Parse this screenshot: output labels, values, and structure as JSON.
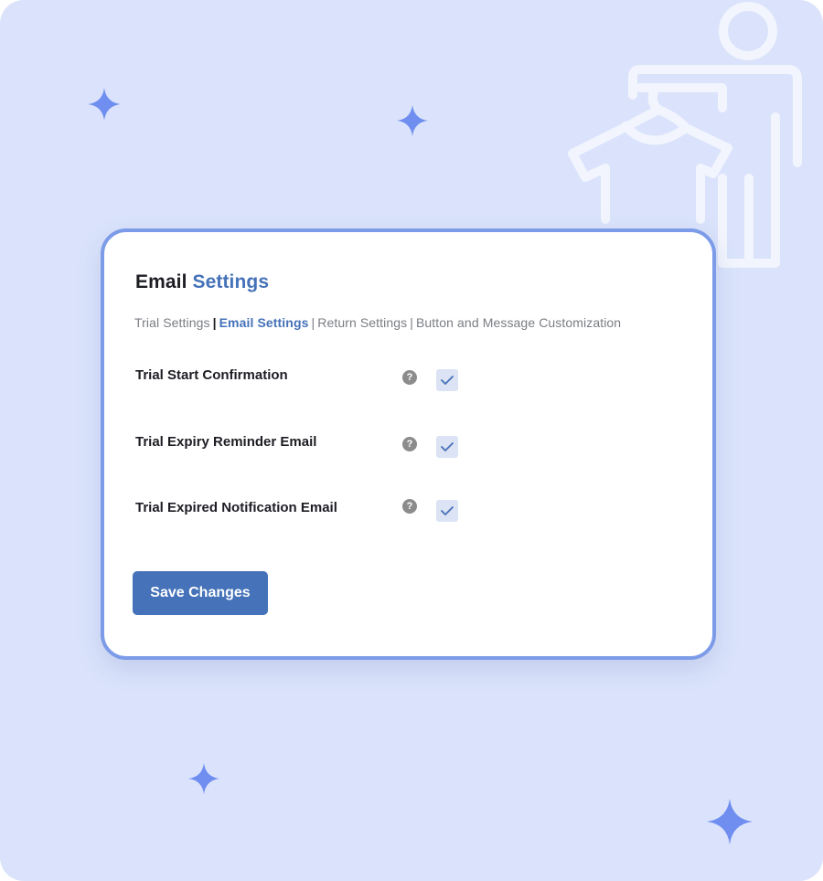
{
  "card": {
    "title_part1": "Email",
    "title_part2": "Settings"
  },
  "tabs": [
    {
      "label": "Trial Settings",
      "active": false
    },
    {
      "label": "Email Settings",
      "active": true
    },
    {
      "label": "Return Settings",
      "active": false
    },
    {
      "label": "Button and Message Customization",
      "active": false
    }
  ],
  "tab_separator": "|",
  "settings": [
    {
      "label": "Trial Start Confirmation",
      "help_icon": "question-circle-icon",
      "checked": true
    },
    {
      "label": "Trial Expiry Reminder Email",
      "help_icon": "question-circle-icon",
      "checked": true
    },
    {
      "label": "Trial Expired Notification Email",
      "help_icon": "question-circle-icon",
      "checked": true
    }
  ],
  "help_glyph": "?",
  "save_button_label": "Save Changes",
  "colors": {
    "background": "#dae3fb",
    "accent": "#4572b8",
    "card_border": "#7c9be8",
    "sparkle": "#6f8ef0",
    "checkbox_bg": "#dbe3f4"
  }
}
